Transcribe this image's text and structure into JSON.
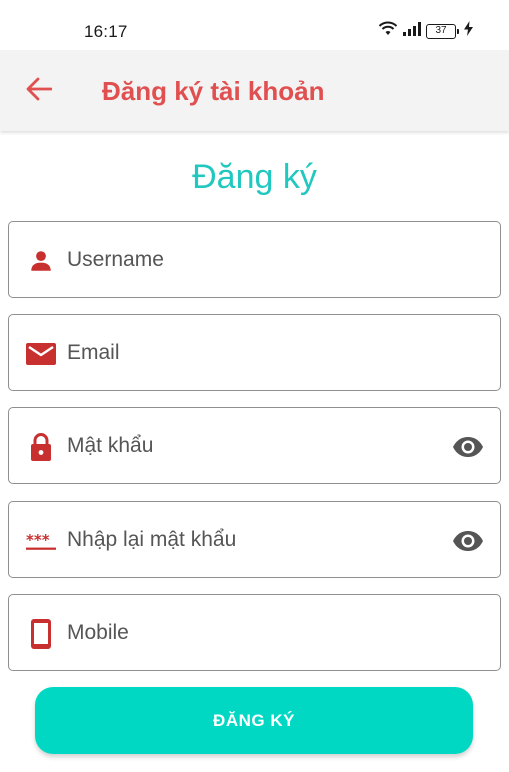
{
  "status_bar": {
    "time": "16:17",
    "battery": "37",
    "icons": [
      "wifi-icon",
      "signal-icon",
      "battery-icon",
      "charging-icon"
    ]
  },
  "app_bar": {
    "back_icon": "arrow-back-icon",
    "title": "Đăng ký tài khoản"
  },
  "page": {
    "heading": "Đăng ký"
  },
  "form": {
    "fields": [
      {
        "icon": "person-icon",
        "placeholder": "Username"
      },
      {
        "icon": "email-icon",
        "placeholder": "Email"
      },
      {
        "icon": "lock-icon",
        "placeholder": "Mật khẩu",
        "trailing_icon": "eye-icon"
      },
      {
        "icon": "password-dots-icon",
        "placeholder": "Nhập lại mật khẩu",
        "trailing_icon": "eye-icon"
      },
      {
        "icon": "phone-icon",
        "placeholder": "Mobile"
      }
    ],
    "submit_label": "ĐĂNG KÝ"
  },
  "colors": {
    "accent_red": "#e05050",
    "icon_red": "#c8302f",
    "teal_heading": "#21c8c0",
    "button_teal": "#00d8c4",
    "app_bar_bg": "#f3f3f3"
  }
}
